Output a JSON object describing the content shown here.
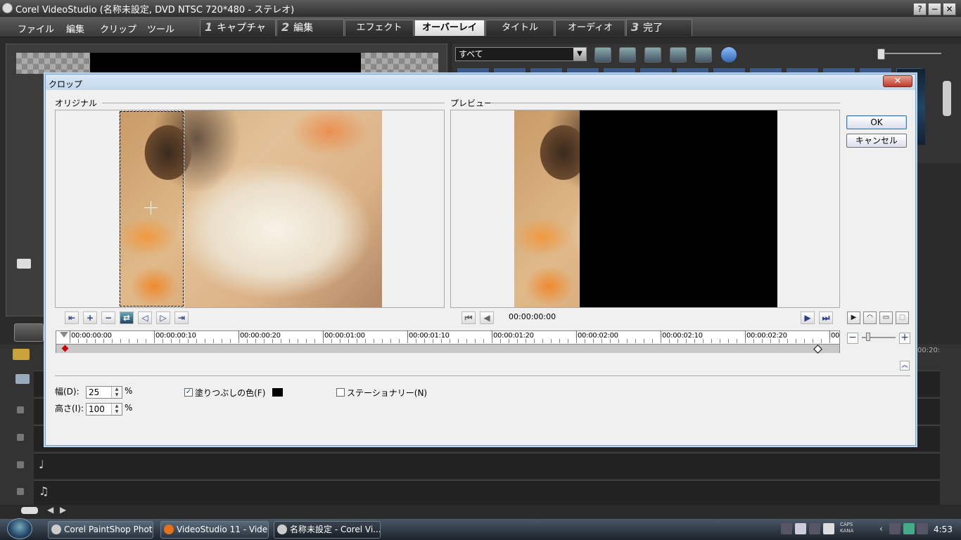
{
  "app": {
    "title": "Corel VideoStudio (名称未設定, DVD NTSC 720*480 - ステレオ)",
    "help": "?",
    "minimize": "−",
    "close": "✕"
  },
  "menu": [
    "ファイル",
    "編集",
    "クリップ",
    "ツール"
  ],
  "steps": [
    {
      "num": "1",
      "label": "キャプチャ"
    },
    {
      "num": "2",
      "label": "編集"
    },
    {
      "num": "3",
      "label": "完了"
    }
  ],
  "tabs": [
    {
      "label": "エフェクト",
      "active": false
    },
    {
      "label": "オーバーレイ",
      "active": true
    },
    {
      "label": "タイトル",
      "active": false
    },
    {
      "label": "オーディオ",
      "active": false
    }
  ],
  "library": {
    "filter": "すべて"
  },
  "timeline": {
    "time_partial": "00:20:"
  },
  "dialog": {
    "title": "クロップ",
    "close": "✕",
    "original_label": "オリジナル",
    "preview_label": "プレビュー",
    "preview_time": "00:00:00:00",
    "ok": "OK",
    "cancel": "キャンセル",
    "ruler_ticks": [
      "00:00:00:00",
      "00:00:00:10",
      "00:00:00:20",
      "00:00:01:00",
      "00:00:01:10",
      "00:00:01:20",
      "00:00:02:00",
      "00:00:02:10",
      "00:00:02:20",
      "00:"
    ],
    "width_label": "幅(D):",
    "width_value": "25",
    "height_label": "高さ(I):",
    "height_value": "100",
    "percent": "%",
    "fill_color_label": "塗りつぶしの色(F)",
    "fill_color_checked": true,
    "fill_color": "#000000",
    "stationary_label": "ステーショナリー(N)",
    "stationary_checked": false
  },
  "taskbar": {
    "items": [
      "Corel PaintShop Photo...",
      "VideoStudio 11 - Video...",
      "名称未設定 - Corel Vi..."
    ],
    "caps": "CAPS",
    "kana": "KANA",
    "time": "4:53"
  }
}
